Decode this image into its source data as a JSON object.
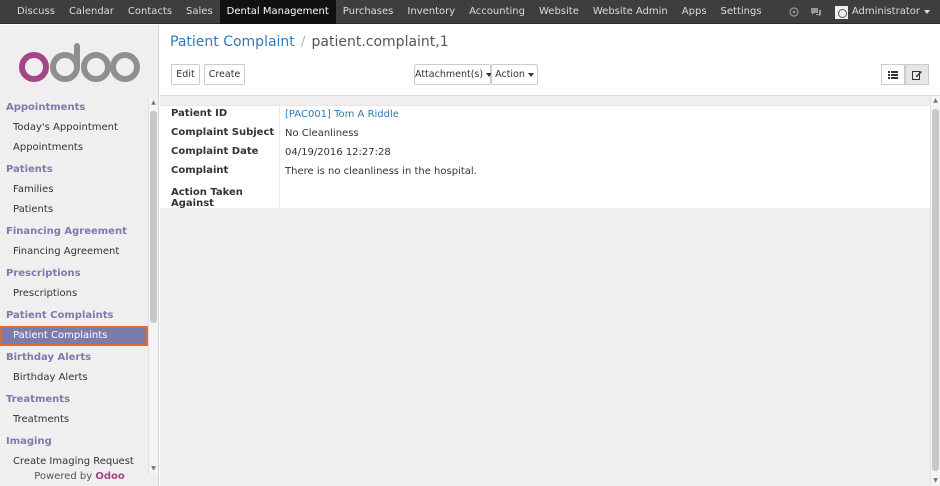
{
  "topbar": {
    "menu": [
      "Discuss",
      "Calendar",
      "Contacts",
      "Sales",
      "Dental Management",
      "Purchases",
      "Inventory",
      "Accounting",
      "Website",
      "Website Admin",
      "Apps",
      "Settings"
    ],
    "active_menu": "Dental Management",
    "user": "Administrator"
  },
  "sidebar": {
    "logo_text": "odoo",
    "sections": [
      {
        "title": "Appointments",
        "items": [
          "Today's Appointment",
          "Appointments"
        ]
      },
      {
        "title": "Patients",
        "items": [
          "Families",
          "Patients"
        ]
      },
      {
        "title": "Financing Agreement",
        "items": [
          "Financing Agreement"
        ]
      },
      {
        "title": "Prescriptions",
        "items": [
          "Prescriptions"
        ]
      },
      {
        "title": "Patient Complaints",
        "items": [
          "Patient Complaints"
        ]
      },
      {
        "title": "Birthday Alerts",
        "items": [
          "Birthday Alerts"
        ]
      },
      {
        "title": "Treatments",
        "items": [
          "Treatments"
        ]
      },
      {
        "title": "Imaging",
        "items": [
          "Create Imaging Request"
        ]
      }
    ],
    "active_item": "Patient Complaints",
    "powered_by_prefix": "Powered by",
    "powered_by_brand": "Odoo"
  },
  "breadcrumb": {
    "parent": "Patient Complaint",
    "current": "patient.complaint,1"
  },
  "buttons": {
    "edit": "Edit",
    "create": "Create",
    "attachments": "Attachment(s)",
    "action": "Action"
  },
  "form": {
    "fields": [
      {
        "label": "Patient ID",
        "value": "[PAC001] Tom A Riddle",
        "link": true
      },
      {
        "label": "Complaint Subject",
        "value": "No Cleanliness",
        "link": false
      },
      {
        "label": "Complaint Date",
        "value": "04/19/2016 12:27:28",
        "link": false
      },
      {
        "label": "Complaint",
        "value": "There is no cleanliness in the hospital.",
        "link": false
      },
      {
        "label": "Action Taken Against",
        "value": "",
        "link": false
      }
    ]
  },
  "colors": {
    "topbar": "#3e3e3e",
    "accent": "#7c7bad",
    "link": "#337ab7",
    "highlight_border": "#e06b2e",
    "brand": "#a24689"
  },
  "icons": [
    "bell-icon",
    "chat-icon",
    "avatar",
    "list-view-icon",
    "form-view-icon"
  ]
}
